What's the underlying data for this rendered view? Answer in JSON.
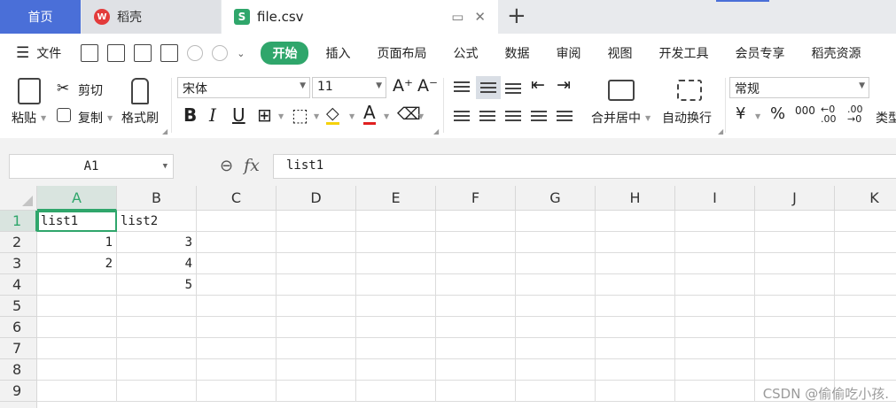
{
  "tabs": {
    "home": "首页",
    "docer": {
      "label": "稻壳",
      "logo": "W"
    },
    "file": {
      "label": "file.csv",
      "logo": "S"
    },
    "add": "+",
    "window_icon": "▭",
    "close_icon": "✕"
  },
  "menubar": {
    "file_label": "文件",
    "items": [
      "开始",
      "插入",
      "页面布局",
      "公式",
      "数据",
      "审阅",
      "视图",
      "开发工具",
      "会员专享",
      "稻壳资源"
    ],
    "active_index": 0
  },
  "ribbon": {
    "paste": "粘贴",
    "cut": "剪切",
    "copy": "复制",
    "format_painter": "格式刷",
    "font_name": "宋体",
    "font_size": "11",
    "merge_center": "合并居中",
    "wrap_text": "自动换行",
    "number_format": "常规",
    "type_conv": "类型",
    "font_grow": "A⁺",
    "font_shrink": "A⁻",
    "bold": "B",
    "italic": "I",
    "underline": "U",
    "currency": "¥",
    "percent": "%",
    "thousands": "000",
    "inc_decimal": "←0\n.00",
    "dec_decimal": ".00\n→0"
  },
  "formula_bar": {
    "cell_ref": "A1",
    "fx": "fx",
    "value": "list1"
  },
  "grid": {
    "columns": [
      "A",
      "B",
      "C",
      "D",
      "E",
      "F",
      "G",
      "H",
      "I",
      "J",
      "K"
    ],
    "rows": [
      "1",
      "2",
      "3",
      "4",
      "5",
      "6",
      "7",
      "8",
      "9"
    ],
    "active_col": "A",
    "active_row": "1",
    "cells": [
      {
        "row": 1,
        "col": "A",
        "value": "list1",
        "type": "text"
      },
      {
        "row": 1,
        "col": "B",
        "value": "list2",
        "type": "text"
      },
      {
        "row": 2,
        "col": "A",
        "value": "1",
        "type": "num"
      },
      {
        "row": 2,
        "col": "B",
        "value": "3",
        "type": "num"
      },
      {
        "row": 3,
        "col": "A",
        "value": "2",
        "type": "num"
      },
      {
        "row": 3,
        "col": "B",
        "value": "4",
        "type": "num"
      },
      {
        "row": 4,
        "col": "B",
        "value": "5",
        "type": "num"
      }
    ]
  },
  "watermark": "CSDN @偷偷吃小孩.",
  "colors": {
    "accent_green": "#2fa66b",
    "home_blue": "#4a6fd8",
    "docer_red": "#e33b3b"
  }
}
